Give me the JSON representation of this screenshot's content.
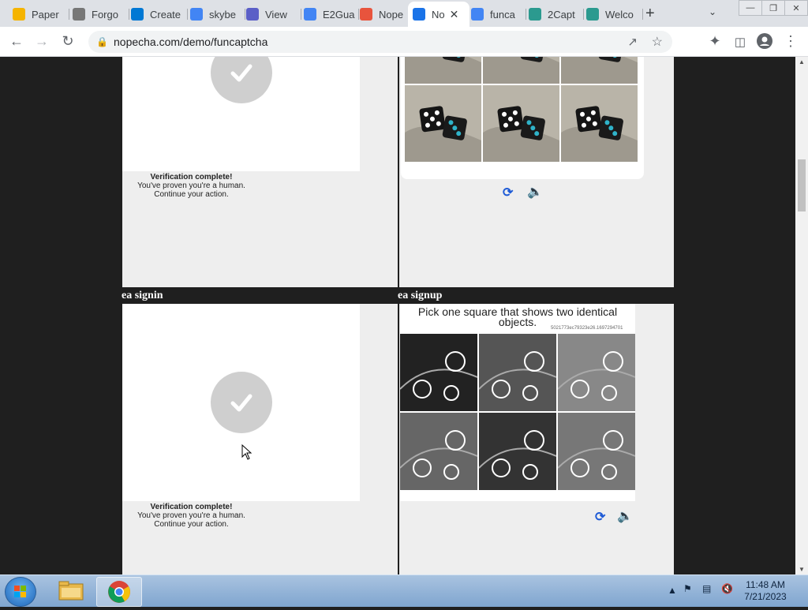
{
  "browser": {
    "tabs": [
      {
        "label": "Paper",
        "icon": "paper-icon",
        "color": "#f5b400"
      },
      {
        "label": "Forgo",
        "icon": "glasses-icon",
        "color": "#777777"
      },
      {
        "label": "Create",
        "icon": "windows-icon",
        "color": "#0078d4"
      },
      {
        "label": "skybe",
        "icon": "google-icon",
        "color": "#4285f4"
      },
      {
        "label": "View",
        "icon": "at-icon",
        "color": "#5b5fc7"
      },
      {
        "label": "E2Gua",
        "icon": "google-icon",
        "color": "#4285f4"
      },
      {
        "label": "Nope",
        "icon": "rainbow-icon",
        "color": "#e8543d"
      },
      {
        "label": "No",
        "icon": "nopecha-icon",
        "color": "#1a73e8",
        "active": true
      },
      {
        "label": "funca",
        "icon": "google-icon",
        "color": "#4285f4"
      },
      {
        "label": "2Capt",
        "icon": "2captcha-icon",
        "color": "#2b9a8f"
      },
      {
        "label": "Welco",
        "icon": "2captcha-icon",
        "color": "#2b9a8f"
      }
    ],
    "url": "nopecha.com/demo/funcaptcha"
  },
  "page": {
    "sections": {
      "top_left_verify": {
        "title": "Verification complete!",
        "line1": "You've proven you're a human.",
        "line2": "Continue your action."
      },
      "ea_signin": {
        "heading": "ea signin",
        "title": "Verification complete!",
        "line1": "You've proven you're a human.",
        "line2": "Continue your action."
      },
      "ea_signup": {
        "heading": "ea signup",
        "prompt": "Pick one square that shows two identical objects.",
        "session_id": "5021773ec79323e26.1697294701"
      }
    }
  },
  "taskbar": {
    "time": "11:48 AM",
    "date": "7/21/2023"
  }
}
